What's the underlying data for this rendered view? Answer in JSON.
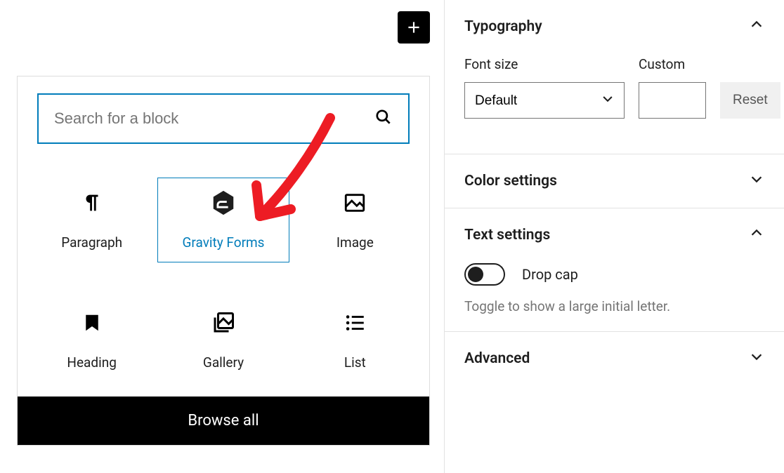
{
  "inserter": {
    "search_placeholder": "Search for a block",
    "blocks": [
      {
        "label": "Paragraph"
      },
      {
        "label": "Gravity Forms"
      },
      {
        "label": "Image"
      },
      {
        "label": "Heading"
      },
      {
        "label": "Gallery"
      },
      {
        "label": "List"
      }
    ],
    "browse_all_label": "Browse all"
  },
  "sidebar": {
    "typography": {
      "title": "Typography",
      "font_size_label": "Font size",
      "font_size_value": "Default",
      "custom_label": "Custom",
      "custom_value": "",
      "reset_label": "Reset"
    },
    "color": {
      "title": "Color settings"
    },
    "text": {
      "title": "Text settings",
      "drop_cap_label": "Drop cap",
      "drop_cap_on": false,
      "help": "Toggle to show a large initial letter."
    },
    "advanced": {
      "title": "Advanced"
    }
  }
}
